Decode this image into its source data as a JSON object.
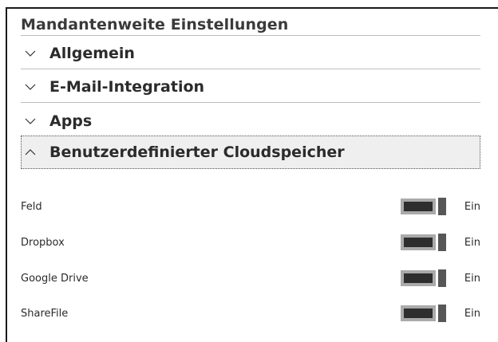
{
  "page": {
    "title": "Mandantenweite Einstellungen"
  },
  "sections": [
    {
      "label": "Allgemein",
      "expanded": false
    },
    {
      "label": "E-Mail-Integration",
      "expanded": false
    },
    {
      "label": "Apps",
      "expanded": false
    },
    {
      "label": "Benutzerdefinierter Cloudspeicher",
      "expanded": true
    }
  ],
  "cloud_storage": {
    "rows": [
      {
        "name": "Feld",
        "state": "Ein",
        "on": true
      },
      {
        "name": "Dropbox",
        "state": "Ein",
        "on": true
      },
      {
        "name": "Google Drive",
        "state": "Ein",
        "on": true
      },
      {
        "name": "ShareFile",
        "state": "Ein",
        "on": true
      }
    ]
  },
  "colors": {
    "toggle_on_fill": "#2e2e2e",
    "toggle_track": "#aaaaaa",
    "expanded_bg": "#efefef"
  },
  "icons": {
    "collapsed": "chevron-down-icon",
    "expanded": "chevron-up-icon"
  }
}
